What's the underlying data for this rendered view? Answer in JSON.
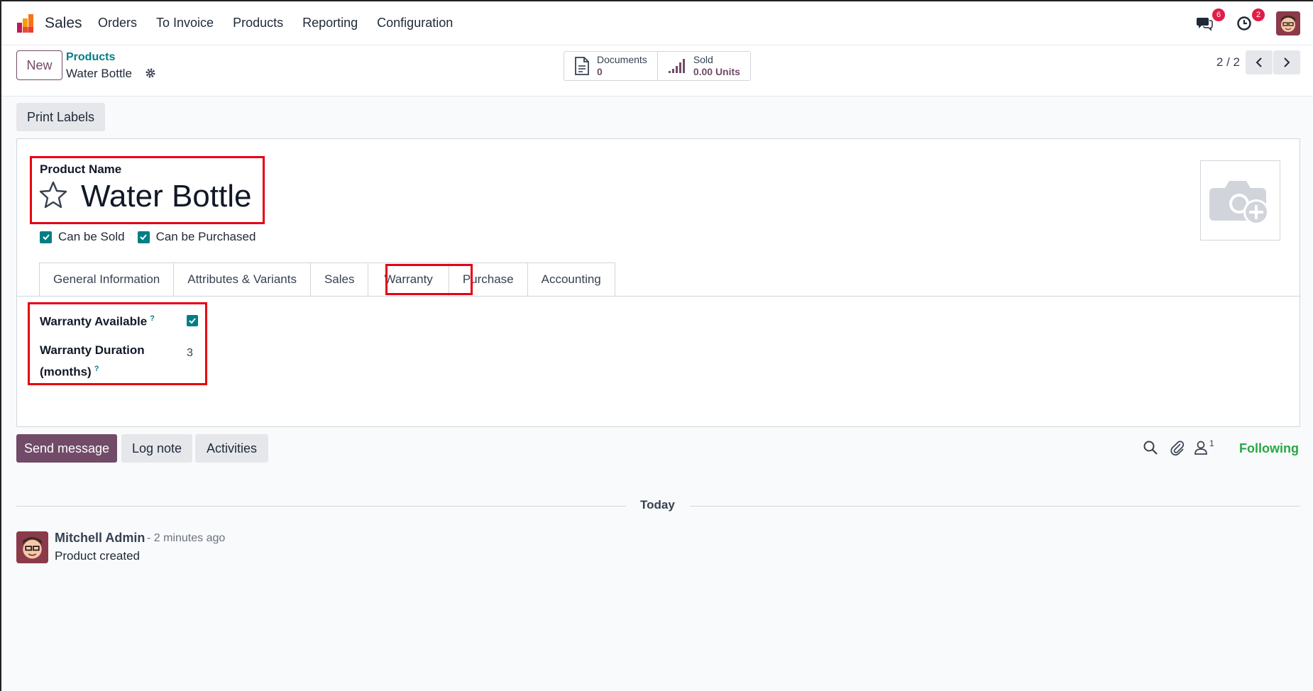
{
  "navbar": {
    "app_name": "Sales",
    "menu": [
      "Orders",
      "To Invoice",
      "Products",
      "Reporting",
      "Configuration"
    ],
    "messages_count": "6",
    "activities_count": "2"
  },
  "control_panel": {
    "new_label": "New",
    "breadcrumb_parent": "Products",
    "breadcrumb_current": "Water Bottle",
    "smart_buttons": [
      {
        "label": "Documents",
        "value": "0"
      },
      {
        "label": "Sold",
        "value": "0.00 Units"
      }
    ],
    "pager": "2 / 2"
  },
  "actions": {
    "print_labels": "Print Labels"
  },
  "form": {
    "product_name_label": "Product Name",
    "product_name": "Water Bottle",
    "can_be_sold": "Can be Sold",
    "can_be_purchased": "Can be Purchased",
    "tabs": [
      "General Information",
      "Attributes & Variants",
      "Sales",
      "Warranty",
      "Purchase",
      "Accounting"
    ],
    "active_tab": "Warranty",
    "warranty_available_label": "Warranty Available",
    "warranty_duration_label_1": "Warranty Duration",
    "warranty_duration_label_2": "(months)",
    "help_mark": "?",
    "warranty_duration_value": "3"
  },
  "chatter": {
    "send_message": "Send message",
    "log_note": "Log note",
    "activities": "Activities",
    "followers_count": "1",
    "following": "Following",
    "date_separator": "Today",
    "message": {
      "author": "Mitchell Admin",
      "time": "- 2 minutes ago",
      "body": "Product created"
    }
  },
  "colors": {
    "primary": "#714b67",
    "teal": "#017e84",
    "highlight": "#e60012",
    "following": "#28a745",
    "badge": "#e11d48"
  }
}
